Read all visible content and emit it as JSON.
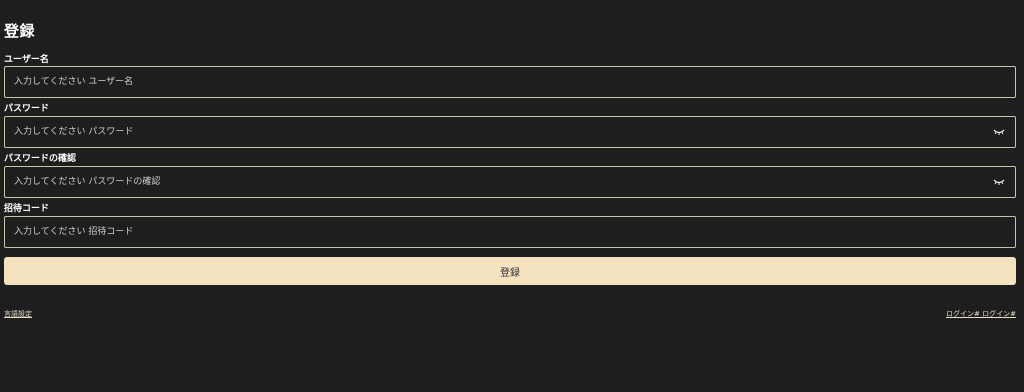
{
  "page": {
    "title": "登録"
  },
  "form": {
    "username": {
      "label": "ユーザー名",
      "placeholder": "入力してください ユーザー名",
      "value": ""
    },
    "password": {
      "label": "パスワード",
      "placeholder": "入力してください パスワード",
      "value": "",
      "icon": "eye-closed-icon"
    },
    "password_confirm": {
      "label": "パスワードの確認",
      "placeholder": "入力してください パスワードの確認",
      "value": "",
      "icon": "eye-closed-icon"
    },
    "invite_code": {
      "label": "招待コード",
      "placeholder": "入力してください 招待コード",
      "value": ""
    },
    "submit_label": "登録"
  },
  "footer": {
    "language_link": "言語設定",
    "login_link": "ログイン# ログイン#"
  },
  "colors": {
    "background": "#1e1e1e",
    "field_border": "#c9c4a6",
    "button_bg": "#f5e3bf",
    "button_text": "#2b2b2b"
  }
}
